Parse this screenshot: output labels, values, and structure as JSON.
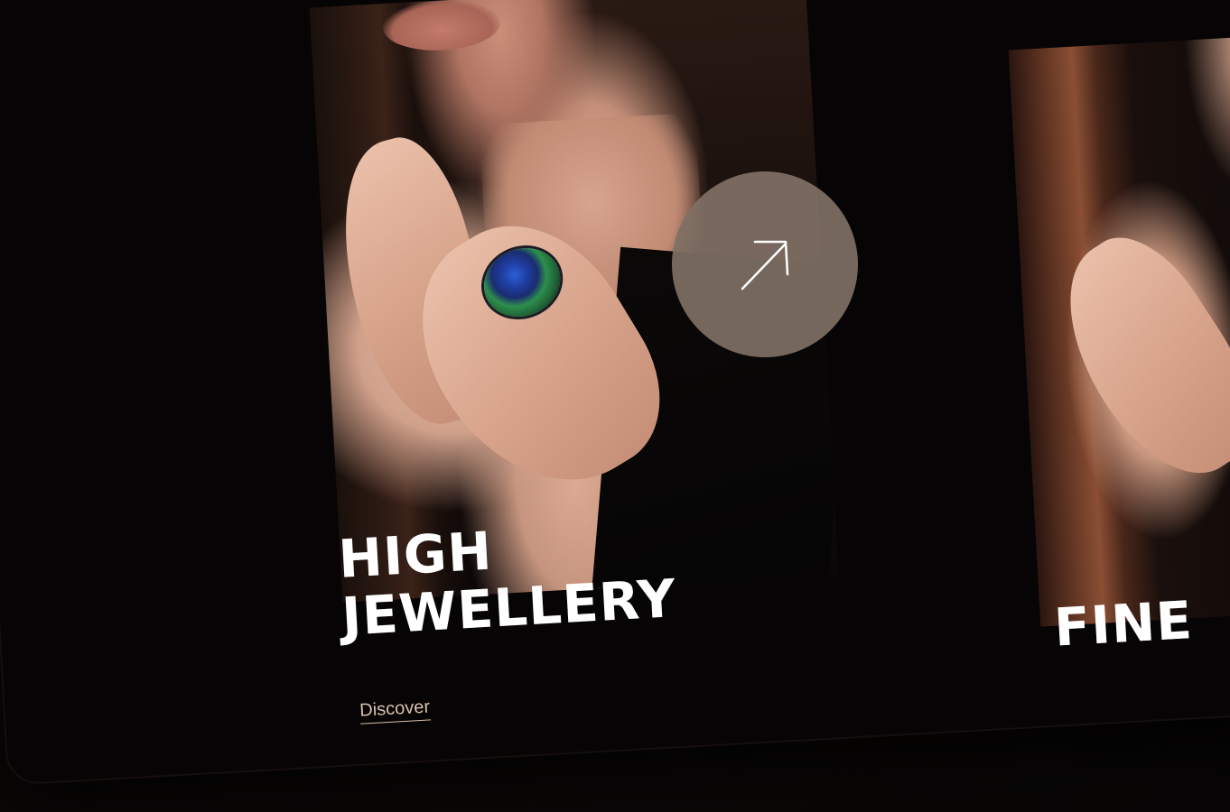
{
  "carousel": {
    "slides": [
      {
        "title_line_1": "HIGH",
        "title_line_2": "JEWELLERY",
        "link_label": "Discover"
      },
      {
        "title_line_1": "FINE"
      }
    ],
    "next_button_icon": "arrow-up-right-icon"
  },
  "colors": {
    "background": "#0d0908",
    "title": "#ffffff",
    "link": "#d8c2ad",
    "button": "#807065"
  }
}
